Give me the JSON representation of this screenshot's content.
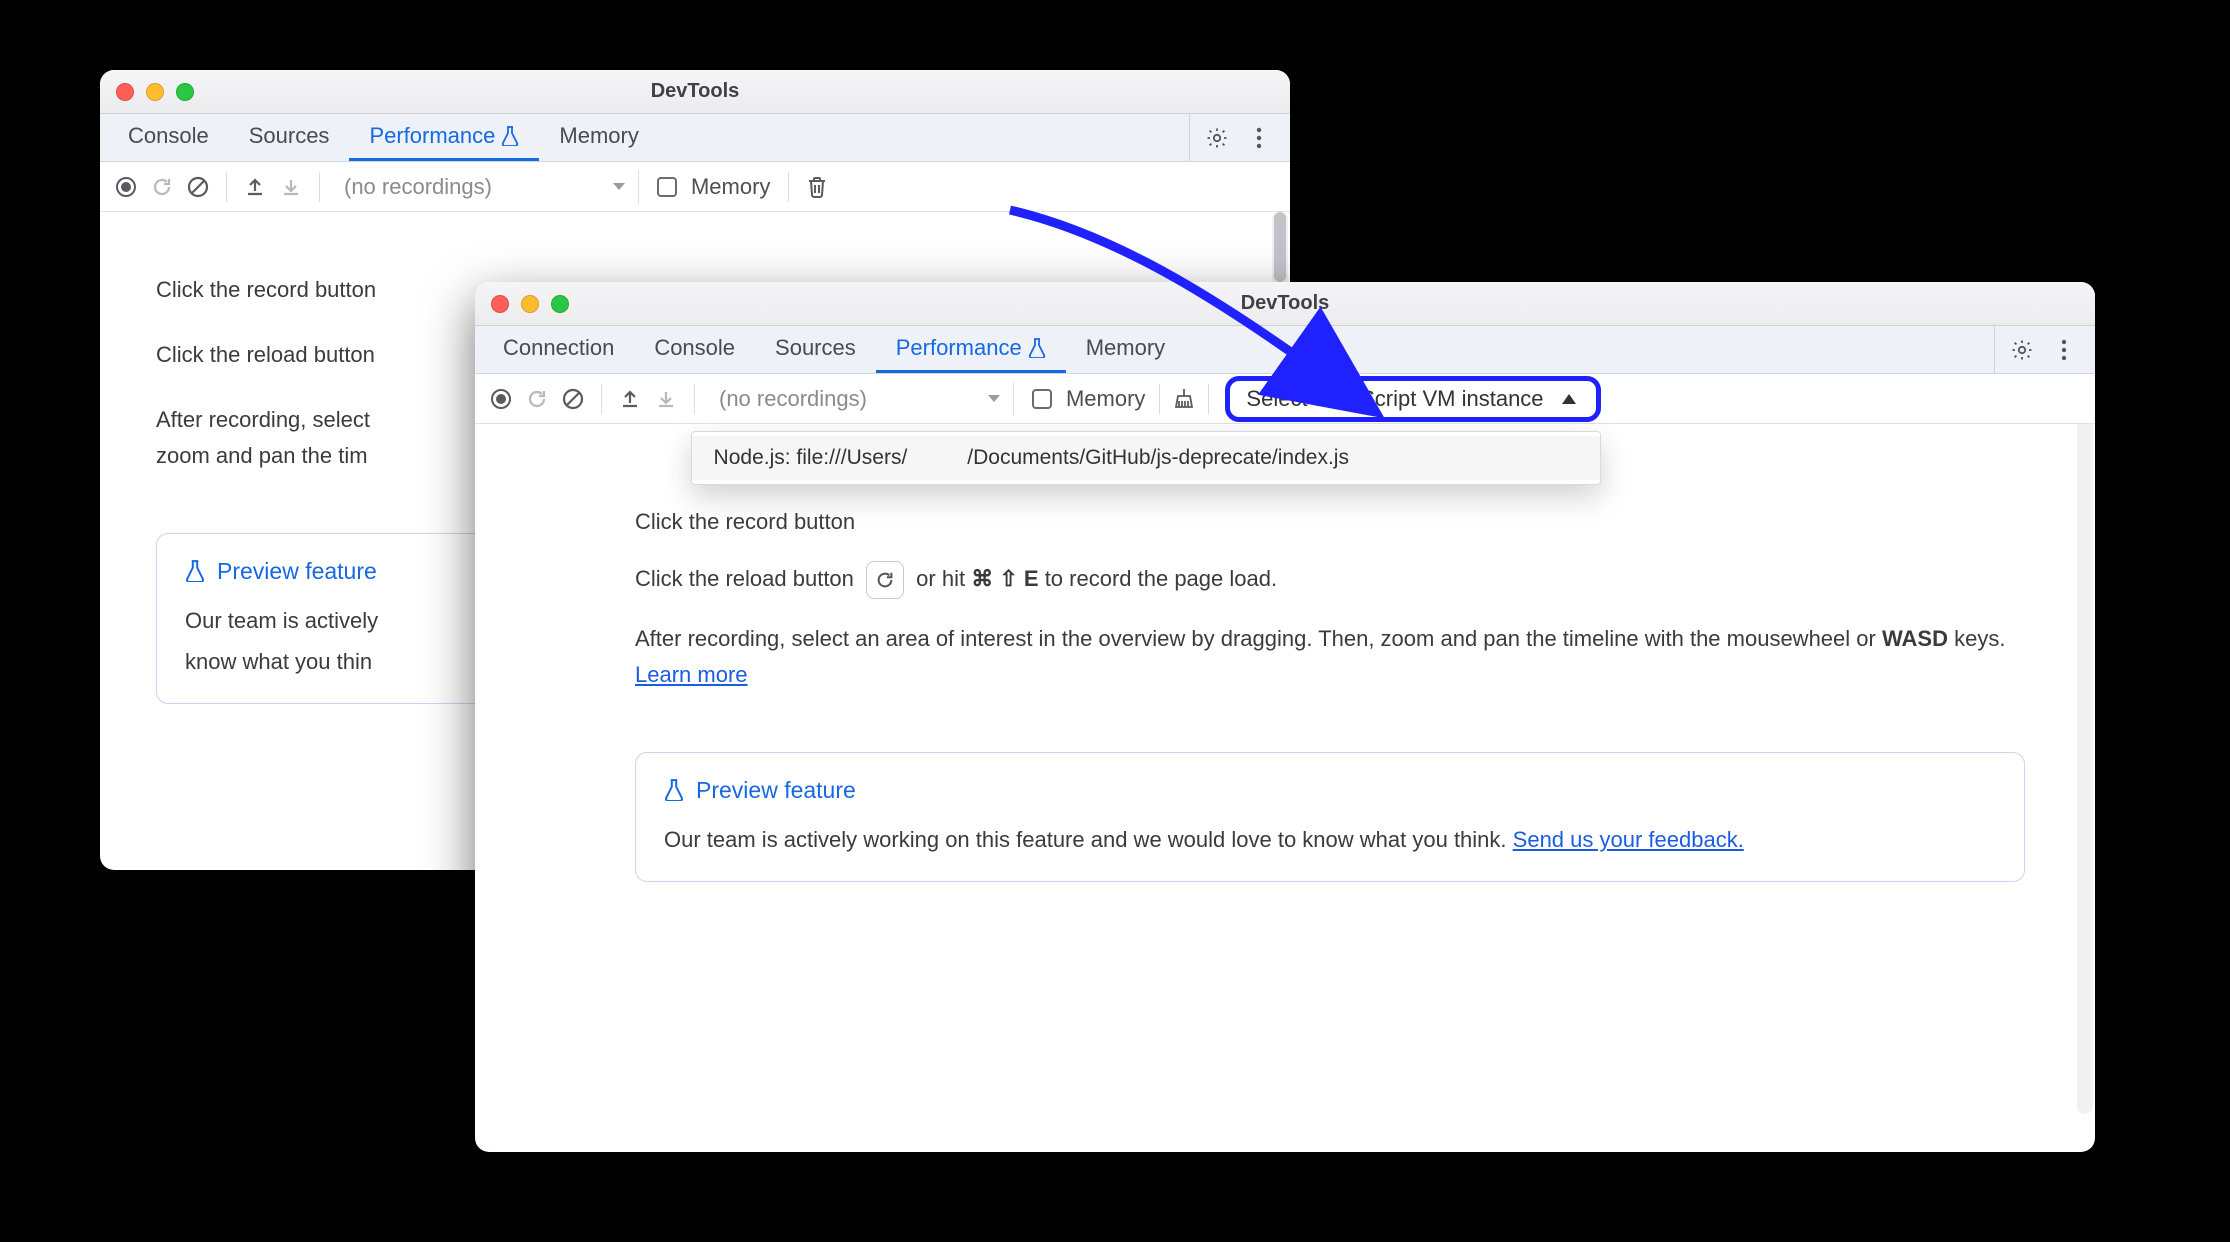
{
  "window_title": "DevTools",
  "tabs_back": [
    "Console",
    "Sources",
    "Performance",
    "Memory"
  ],
  "tabs_front": [
    "Connection",
    "Console",
    "Sources",
    "Performance",
    "Memory"
  ],
  "active_tab": "Performance",
  "recordings_placeholder": "(no recordings)",
  "memory_label": "Memory",
  "vm_selector_label": "Select JavaScript VM instance",
  "vm_option_prefix": "Node.js: file:///Users/",
  "vm_option_suffix": "/Documents/GitHub/js-deprecate/index.js",
  "instructions": {
    "record_prefix": "Click the record button ",
    "record_suffix_partial_back": "",
    "reload_prefix": "Click the reload button ",
    "reload_mid": " or hit ",
    "reload_key_cmd": "⌘",
    "reload_key_shift": "⇧",
    "reload_key_e": "E",
    "reload_suffix": " to record the page load.",
    "after_recording": "After recording, select an area of interest in the overview by dragging. Then, zoom and pan the timeline with the mousewheel or ",
    "wasd": "WASD",
    "after_recording_tail": " keys. ",
    "learn_more": "Learn more"
  },
  "preview": {
    "title": "Preview feature",
    "body_prefix": "Our team is actively working on this feature and we would love to know what you think. ",
    "feedback_link": "Send us your feedback."
  },
  "partial_back": {
    "record": "Click the record button",
    "reload": "Click the reload button",
    "after1": "After recording, select",
    "after2": "zoom and pan the tim",
    "preview_body1": "Our team is actively",
    "preview_body2": "know what you thin"
  }
}
